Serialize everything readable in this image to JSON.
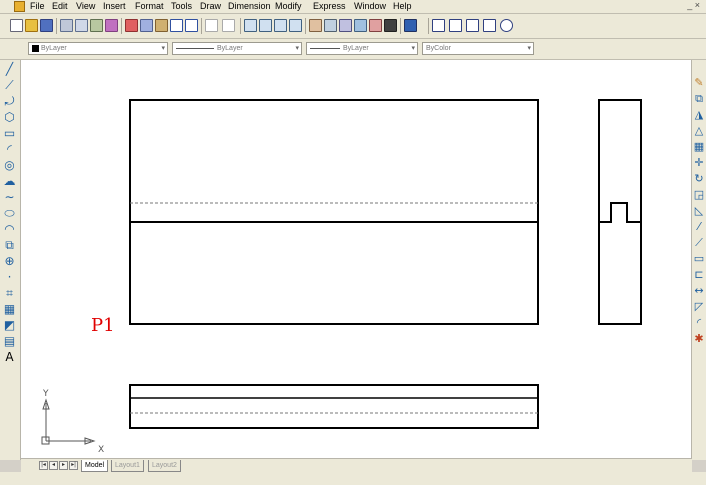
{
  "menu": [
    "File",
    "Edit",
    "View",
    "Insert",
    "Format",
    "Tools",
    "Draw",
    "Dimension",
    "Modify",
    "Express",
    "Window",
    "Help"
  ],
  "window_controls": "_ ×",
  "properties": {
    "layer": "ByLayer",
    "linetype": "ByLayer",
    "lineweight": "ByLayer",
    "color": "ByColor"
  },
  "canvas": {
    "point_label": "P1",
    "point_label_color": "#e00000",
    "ucs_x_label": "X",
    "ucs_y_label": "Y"
  },
  "tabs": [
    "Model",
    "Layout1",
    "Layout2"
  ],
  "active_tab": "Model",
  "colors": {
    "toolbar_bg": "#ece9d8",
    "canvas_bg": "#ffffff",
    "icon_blue": "#2060a0"
  }
}
